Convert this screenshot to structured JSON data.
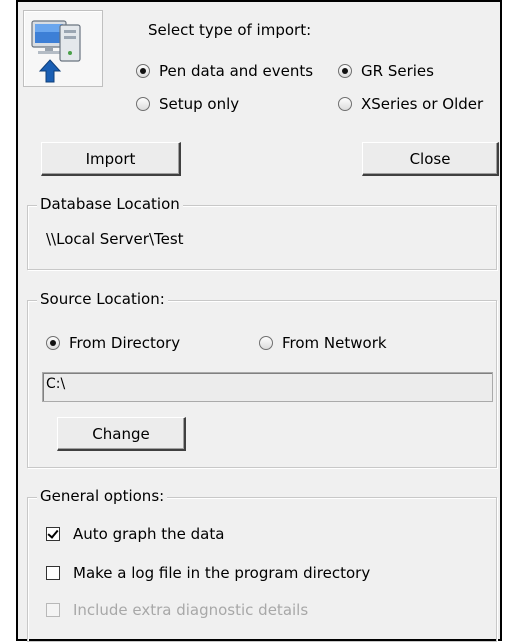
{
  "import_type": {
    "heading": "Select type of import:",
    "options_left": [
      {
        "label": "Pen data and events",
        "checked": true
      },
      {
        "label": "Setup only",
        "checked": false
      }
    ],
    "options_right": [
      {
        "label": "GR Series",
        "checked": true
      },
      {
        "label": "XSeries or Older",
        "checked": false
      }
    ]
  },
  "buttons": {
    "import": "Import",
    "close": "Close",
    "change": "Change"
  },
  "database": {
    "title": "Database Location",
    "path": "\\\\Local Server\\Test"
  },
  "source": {
    "title": "Source Location:",
    "from_directory": "From Directory",
    "from_network": "From Network",
    "selected": "From Directory",
    "path_value": "C:\\"
  },
  "general": {
    "title": "General options:",
    "options": [
      {
        "label": "Auto graph the data",
        "checked": true,
        "enabled": true
      },
      {
        "label": "Make a log file in the program directory",
        "checked": false,
        "enabled": true
      },
      {
        "label": "Include extra diagnostic details",
        "checked": false,
        "enabled": false
      }
    ]
  },
  "icon": {
    "name": "computer-import-icon",
    "arrow_color": "#1a5fb4"
  }
}
